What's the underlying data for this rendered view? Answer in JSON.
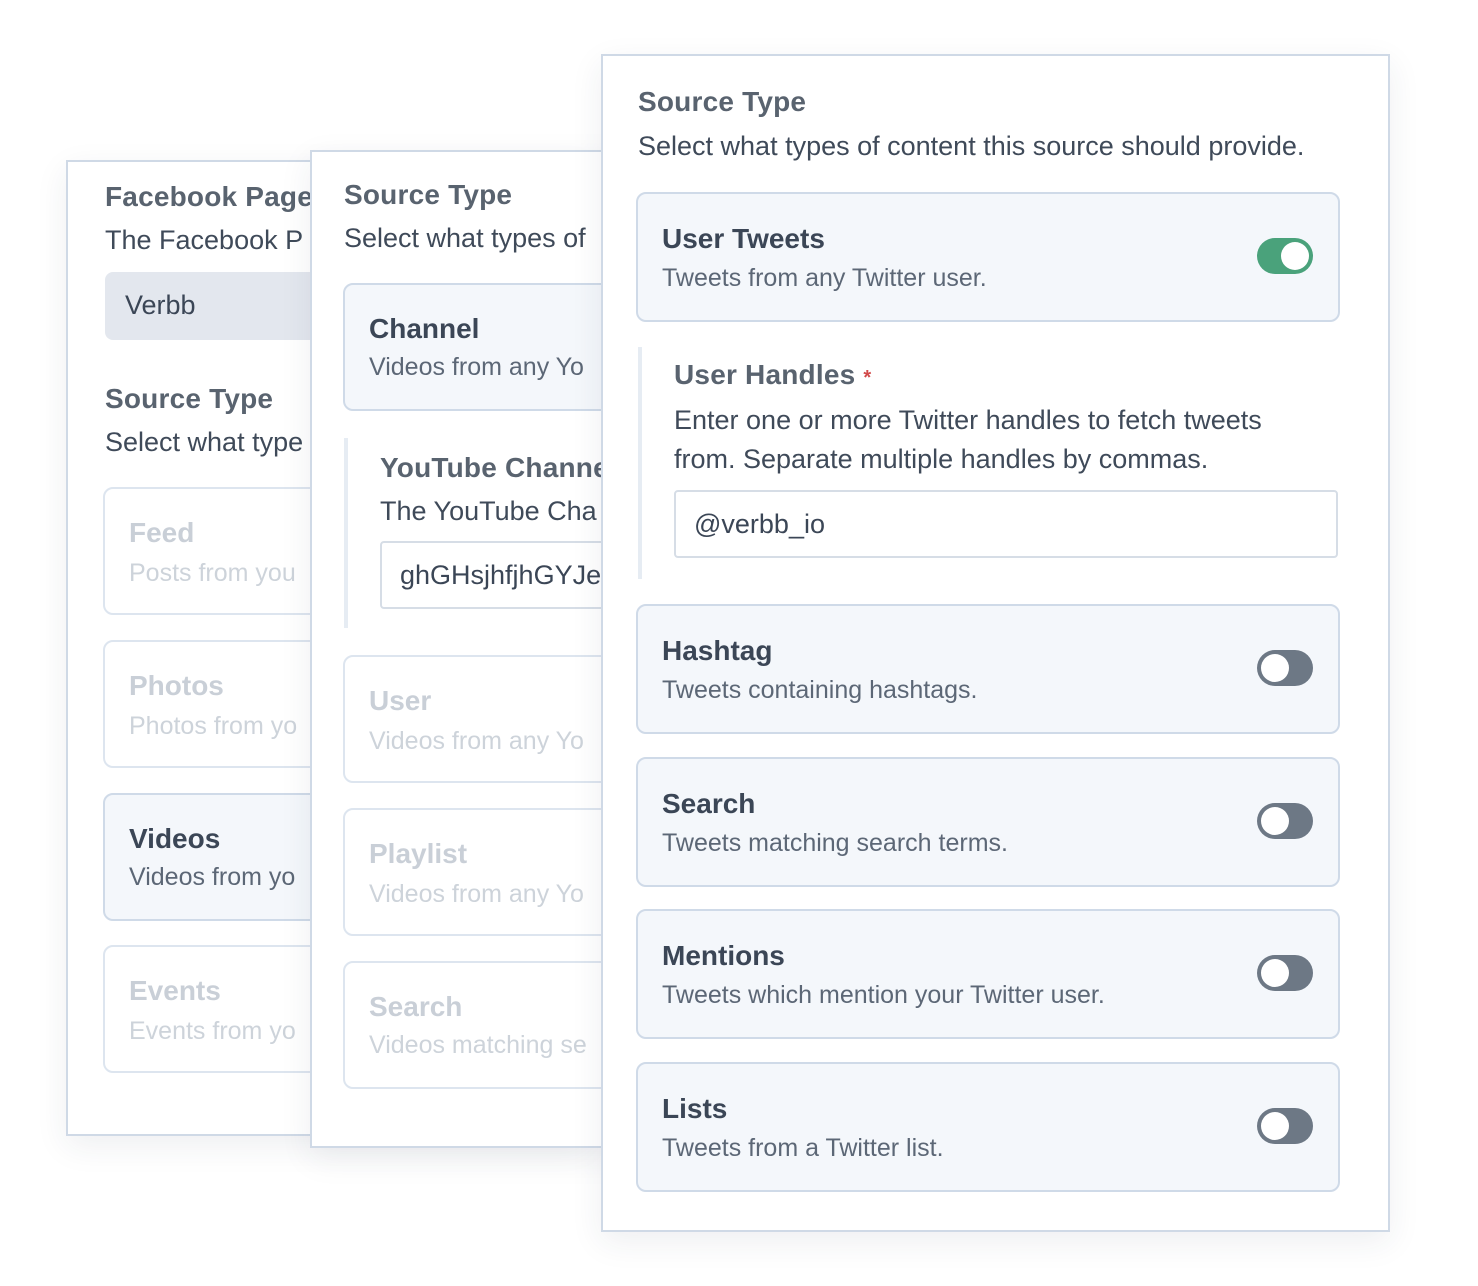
{
  "facebook_panel": {
    "page_label": "Facebook Page",
    "page_desc": "The Facebook P",
    "page_value": "Verbb",
    "source_type_label": "Source Type",
    "source_type_desc": "Select what type",
    "options": [
      {
        "title": "Feed",
        "desc": "Posts from you"
      },
      {
        "title": "Photos",
        "desc": "Photos from yo"
      },
      {
        "title": "Videos",
        "desc": "Videos from yo"
      },
      {
        "title": "Events",
        "desc": "Events from yo"
      }
    ]
  },
  "youtube_panel": {
    "source_type_label": "Source Type",
    "source_type_desc": "Select what types of",
    "channel_option": {
      "title": "Channel",
      "desc": "Videos from any Yo"
    },
    "channel_field_label": "YouTube Channe",
    "channel_field_desc": "The YouTube Cha",
    "channel_field_value": "ghGHsjhfjhGYJe",
    "options": [
      {
        "title": "User",
        "desc": "Videos from any Yo"
      },
      {
        "title": "Playlist",
        "desc": "Videos from any Yo"
      },
      {
        "title": "Search",
        "desc": "Videos matching se"
      }
    ]
  },
  "twitter_panel": {
    "source_type_label": "Source Type",
    "source_type_desc": "Select what types of content this source should provide.",
    "user_tweets": {
      "title": "User Tweets",
      "desc": "Tweets from any Twitter user.",
      "enabled": true
    },
    "user_handles": {
      "label": "User Handles",
      "required_mark": "*",
      "desc_line1": "Enter one or more Twitter handles to fetch tweets",
      "desc_line2": "from. Separate multiple handles by commas.",
      "value": "@verbb_io"
    },
    "options": [
      {
        "title": "Hashtag",
        "desc": "Tweets containing hashtags.",
        "enabled": false
      },
      {
        "title": "Search",
        "desc": "Tweets matching search terms.",
        "enabled": false
      },
      {
        "title": "Mentions",
        "desc": "Tweets which mention your Twitter user.",
        "enabled": false
      },
      {
        "title": "Lists",
        "desc": "Tweets from a Twitter list.",
        "enabled": false
      }
    ]
  },
  "colors": {
    "toggle_on": "#4aa27b",
    "toggle_off": "#6d7885",
    "required": "#d24a4a",
    "panel_border": "#cfd9e6"
  }
}
